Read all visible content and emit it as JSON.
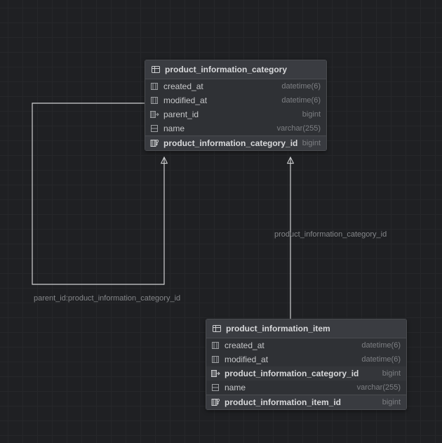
{
  "tables": {
    "category": {
      "title": "product_information_category",
      "columns": [
        {
          "name": "created_at",
          "type": "datetime(6)"
        },
        {
          "name": "modified_at",
          "type": "datetime(6)"
        },
        {
          "name": "parent_id",
          "type": "bigint"
        },
        {
          "name": "name",
          "type": "varchar(255)"
        }
      ],
      "pk": {
        "name": "product_information_category_id",
        "type": "bigint"
      }
    },
    "item": {
      "title": "product_information_item",
      "columns": [
        {
          "name": "created_at",
          "type": "datetime(6)"
        },
        {
          "name": "modified_at",
          "type": "datetime(6)"
        },
        {
          "name": "product_information_category_id",
          "type": "bigint"
        },
        {
          "name": "name",
          "type": "varchar(255)"
        }
      ],
      "pk": {
        "name": "product_information_item_id",
        "type": "bigint"
      }
    }
  },
  "relations": {
    "self": "parent_id:product_information_category_id",
    "fk": "product_information_category_id"
  }
}
